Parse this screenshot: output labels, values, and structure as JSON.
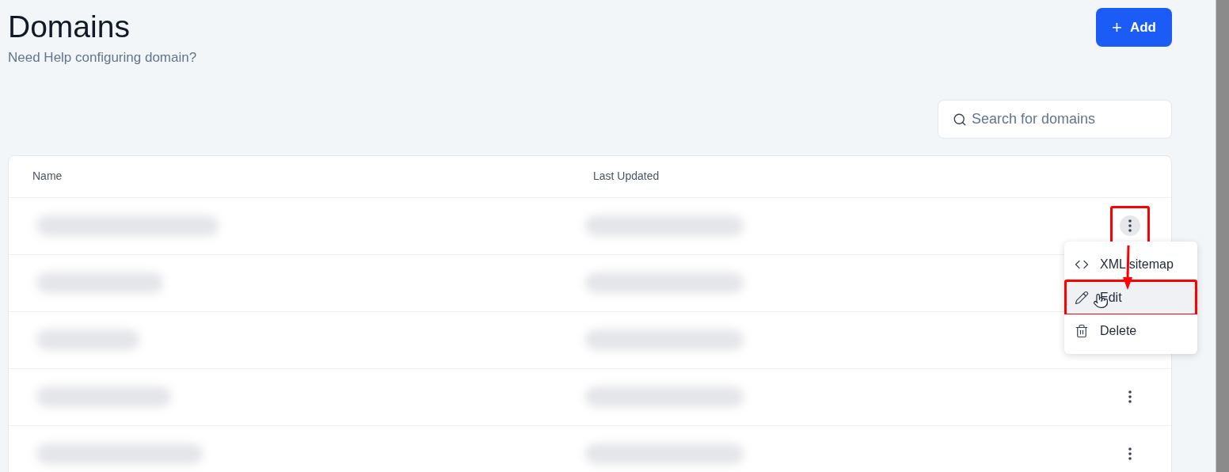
{
  "header": {
    "title": "Domains",
    "subtitle": "Need Help configuring domain?",
    "add_button": {
      "icon": "+",
      "label": "Add"
    }
  },
  "search": {
    "placeholder": "Search for domains"
  },
  "table": {
    "columns": [
      "Name",
      "Last Updated"
    ],
    "rows": [
      {
        "menu_open": true
      },
      {
        "menu_open": false
      },
      {
        "menu_open": false
      },
      {
        "menu_open": false
      },
      {
        "menu_open": false
      }
    ]
  },
  "row_menu": {
    "items": [
      {
        "kind": "code",
        "label": "XML sitemap",
        "highlighted": false
      },
      {
        "kind": "edit",
        "label": "Edit",
        "highlighted": true
      },
      {
        "kind": "delete",
        "label": "Delete",
        "highlighted": false
      }
    ]
  }
}
